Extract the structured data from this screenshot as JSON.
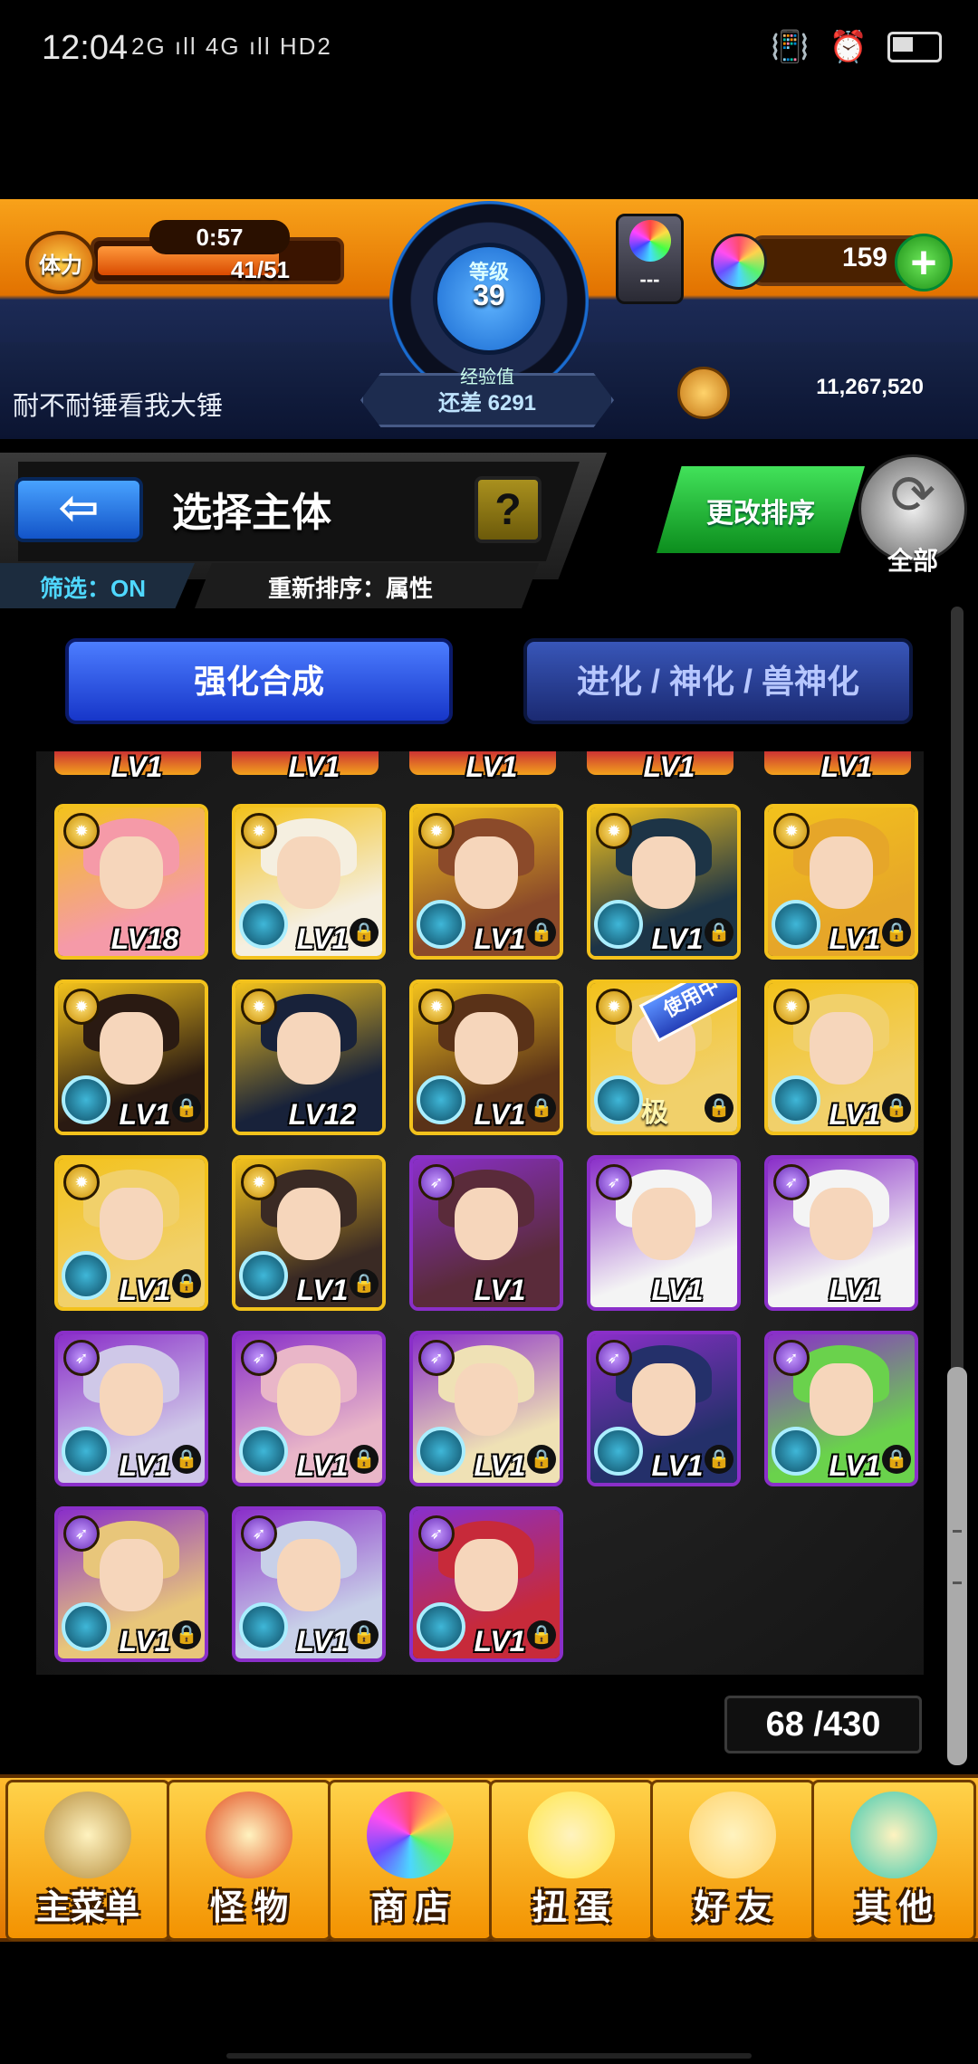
{
  "status_bar": {
    "time": "12:04",
    "signal": "2G ıll  4G ıll HD2"
  },
  "hud": {
    "stamina_label": "体力",
    "stamina_timer": "0:57",
    "stamina_value": "41/51",
    "stamina_fraction": 0.8,
    "level_label": "等级",
    "level_value": "39",
    "exp_label": "经验值",
    "exp_value": "还差 6291",
    "box_label": "---",
    "orb_value": "159",
    "plus_label": "+",
    "username": "耐不耐锤看我大锤",
    "coin_value": "11,267,520"
  },
  "header": {
    "back_label": "⇦",
    "title": "选择主体",
    "help_label": "?",
    "filter": "筛选：ON",
    "sort": "重新排序：属性",
    "change_sort": "更改排序",
    "all_label": "全部"
  },
  "tabs": {
    "strengthen": "强化合成",
    "evolve": "进化 / 神化 / 兽神化"
  },
  "partial_row": [
    "LV1",
    "LV1",
    "LV1",
    "LV1",
    "LV1"
  ],
  "monsters": [
    {
      "level": "LV18",
      "element": "light",
      "locked": false,
      "bubble": false,
      "colors": [
        "#f3c21c",
        "#f59aa8"
      ]
    },
    {
      "level": "LV1",
      "element": "light",
      "locked": true,
      "bubble": true,
      "colors": [
        "#f3c21c",
        "#f5efe0"
      ]
    },
    {
      "level": "LV1",
      "element": "light",
      "locked": true,
      "bubble": true,
      "colors": [
        "#f3c21c",
        "#8b4a2a"
      ]
    },
    {
      "level": "LV1",
      "element": "light",
      "locked": true,
      "bubble": true,
      "colors": [
        "#f3c21c",
        "#1d3446"
      ]
    },
    {
      "level": "LV1",
      "element": "light",
      "locked": true,
      "bubble": true,
      "colors": [
        "#f3c21c",
        "#e6a629"
      ]
    },
    {
      "level": "LV1",
      "element": "light",
      "locked": true,
      "bubble": true,
      "colors": [
        "#f3c21c",
        "#2a1a12"
      ]
    },
    {
      "level": "LV12",
      "element": "light",
      "locked": false,
      "bubble": false,
      "colors": [
        "#f3c21c",
        "#18223a"
      ]
    },
    {
      "level": "LV1",
      "element": "light",
      "locked": true,
      "bubble": true,
      "colors": [
        "#f3c21c",
        "#5a3218"
      ]
    },
    {
      "level": "",
      "element": "light",
      "locked": true,
      "bubble": true,
      "in_use": "使用中",
      "mark": "极",
      "colors": [
        "#f3c21c",
        "#f1d06a"
      ]
    },
    {
      "level": "LV1",
      "element": "light",
      "locked": true,
      "bubble": true,
      "colors": [
        "#f3c21c",
        "#f1d06a"
      ]
    },
    {
      "level": "LV1",
      "element": "light",
      "locked": true,
      "bubble": true,
      "colors": [
        "#f3c21c",
        "#f1d06a"
      ]
    },
    {
      "level": "LV1",
      "element": "light",
      "locked": true,
      "bubble": true,
      "colors": [
        "#f3c21c",
        "#3a2a24"
      ]
    },
    {
      "level": "LV1",
      "element": "dark",
      "locked": false,
      "bubble": false,
      "colors": [
        "#8a2fc9",
        "#5a2b3a"
      ]
    },
    {
      "level": "LV1",
      "element": "dark",
      "locked": false,
      "bubble": false,
      "colors": [
        "#8a2fc9",
        "#f4f4f4"
      ]
    },
    {
      "level": "LV1",
      "element": "dark",
      "locked": false,
      "bubble": false,
      "colors": [
        "#8a2fc9",
        "#f4f4f4"
      ]
    },
    {
      "level": "LV1",
      "element": "dark",
      "locked": true,
      "bubble": true,
      "colors": [
        "#8a2fc9",
        "#cfc8e8"
      ]
    },
    {
      "level": "LV1",
      "element": "dark",
      "locked": true,
      "bubble": true,
      "colors": [
        "#8a2fc9",
        "#e9b6c8"
      ]
    },
    {
      "level": "LV1",
      "element": "dark",
      "locked": true,
      "bubble": true,
      "colors": [
        "#8a2fc9",
        "#efe1b5"
      ]
    },
    {
      "level": "LV1",
      "element": "dark",
      "locked": true,
      "bubble": true,
      "colors": [
        "#8a2fc9",
        "#24306a"
      ]
    },
    {
      "level": "LV1",
      "element": "dark",
      "locked": true,
      "bubble": true,
      "colors": [
        "#8a2fc9",
        "#6ad24c"
      ]
    },
    {
      "level": "LV1",
      "element": "dark",
      "locked": true,
      "bubble": true,
      "colors": [
        "#8a2fc9",
        "#e8c67a"
      ]
    },
    {
      "level": "LV1",
      "element": "dark",
      "locked": true,
      "bubble": true,
      "colors": [
        "#8a2fc9",
        "#c8d0e8"
      ]
    },
    {
      "level": "LV1",
      "element": "dark",
      "locked": true,
      "bubble": true,
      "colors": [
        "#8a2fc9",
        "#c72a3a"
      ]
    }
  ],
  "box_count": "68 /430",
  "bottom_nav": [
    {
      "label": "主菜单",
      "icon": "castle-icon",
      "color": "#b58b3a"
    },
    {
      "label": "怪 物",
      "icon": "monster-icon",
      "color": "#e24a1c"
    },
    {
      "label": "商 店",
      "icon": "orb-icon",
      "color": "#7b5cff"
    },
    {
      "label": "扭 蛋",
      "icon": "egg-icon",
      "color": "#ffe64a"
    },
    {
      "label": "好 友",
      "icon": "friends-icon",
      "color": "#ffd36b"
    },
    {
      "label": "其 他",
      "icon": "other-icon",
      "color": "#3ec9b0"
    }
  ],
  "colors": {
    "accent_orange": "#f08a00",
    "accent_blue": "#1f5bd8",
    "accent_green": "#1bab2b"
  }
}
